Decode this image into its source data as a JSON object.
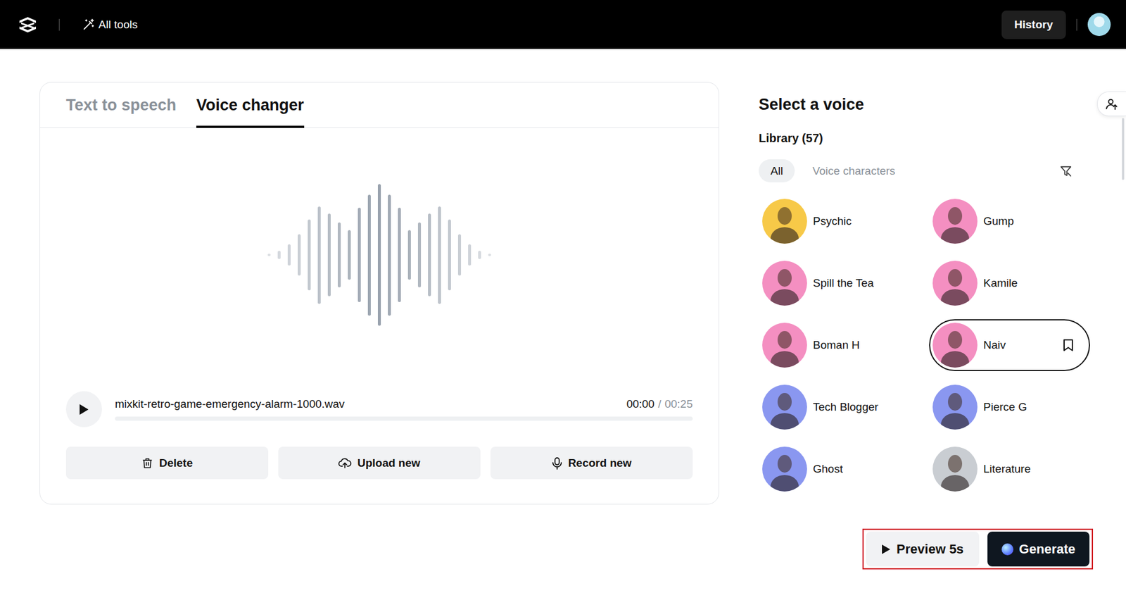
{
  "topbar": {
    "all_tools": "All tools",
    "history": "History"
  },
  "tabs": [
    {
      "label": "Text to speech",
      "selected": false
    },
    {
      "label": "Voice changer",
      "selected": true
    }
  ],
  "player": {
    "file": "mixkit-retro-game-emergency-alarm-1000.wav",
    "current": "00:00",
    "separator": "/",
    "duration": "00:25",
    "level": 0
  },
  "actions": [
    {
      "label": "Delete",
      "kind": "delete"
    },
    {
      "label": "Upload new",
      "kind": "upload"
    },
    {
      "label": "Record new",
      "kind": "record"
    }
  ],
  "voice_panel": {
    "title": "Select a voice",
    "library": "Library (57)",
    "filters": [
      {
        "label": "All",
        "selected": true
      },
      {
        "label": "Voice characters",
        "selected": false
      }
    ]
  },
  "voices": [
    {
      "name": "Psychic",
      "selected": false,
      "bookmark": false,
      "color": "#f7c948"
    },
    {
      "name": "Gump",
      "selected": false,
      "bookmark": false,
      "color": "#f48fc1"
    },
    {
      "name": "Spill the Tea",
      "selected": false,
      "bookmark": false,
      "color": "#f48fc1"
    },
    {
      "name": "Kamile",
      "selected": false,
      "bookmark": false,
      "color": "#f48fc1"
    },
    {
      "name": "Boman H",
      "selected": false,
      "bookmark": false,
      "color": "#f48fc1"
    },
    {
      "name": "Naiv",
      "selected": true,
      "bookmark": true,
      "color": "#f48fc1"
    },
    {
      "name": "Tech Blogger",
      "selected": false,
      "bookmark": false,
      "color": "#8a97f0"
    },
    {
      "name": "Pierce G",
      "selected": false,
      "bookmark": false,
      "color": "#8a97f0"
    },
    {
      "name": "Ghost",
      "selected": false,
      "bookmark": false,
      "color": "#8a97f0"
    },
    {
      "name": "Literature",
      "selected": false,
      "bookmark": false,
      "color": "#c9cdd2"
    }
  ],
  "footer": {
    "preview": "Preview 5s",
    "generate": "Generate",
    "highlighted": true
  }
}
